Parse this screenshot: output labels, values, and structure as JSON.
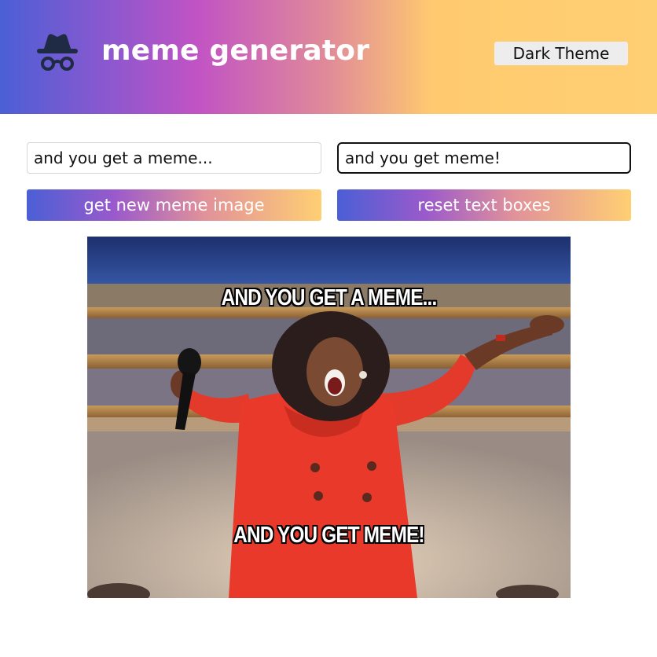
{
  "header": {
    "logo_icon": "incognito-icon",
    "title": "meme generator",
    "theme_toggle_label": "Dark Theme",
    "gradient_colors": [
      "#4b5fd6",
      "#c153c4",
      "#ffca6f"
    ]
  },
  "form": {
    "top_text_value": "and you get a meme...",
    "bottom_text_value": "and you get meme!",
    "new_image_label": "get new meme image",
    "reset_label": "reset text boxes"
  },
  "meme": {
    "top_caption": "AND YOU GET A MEME...",
    "bottom_caption": "AND YOU GET MEME!"
  }
}
